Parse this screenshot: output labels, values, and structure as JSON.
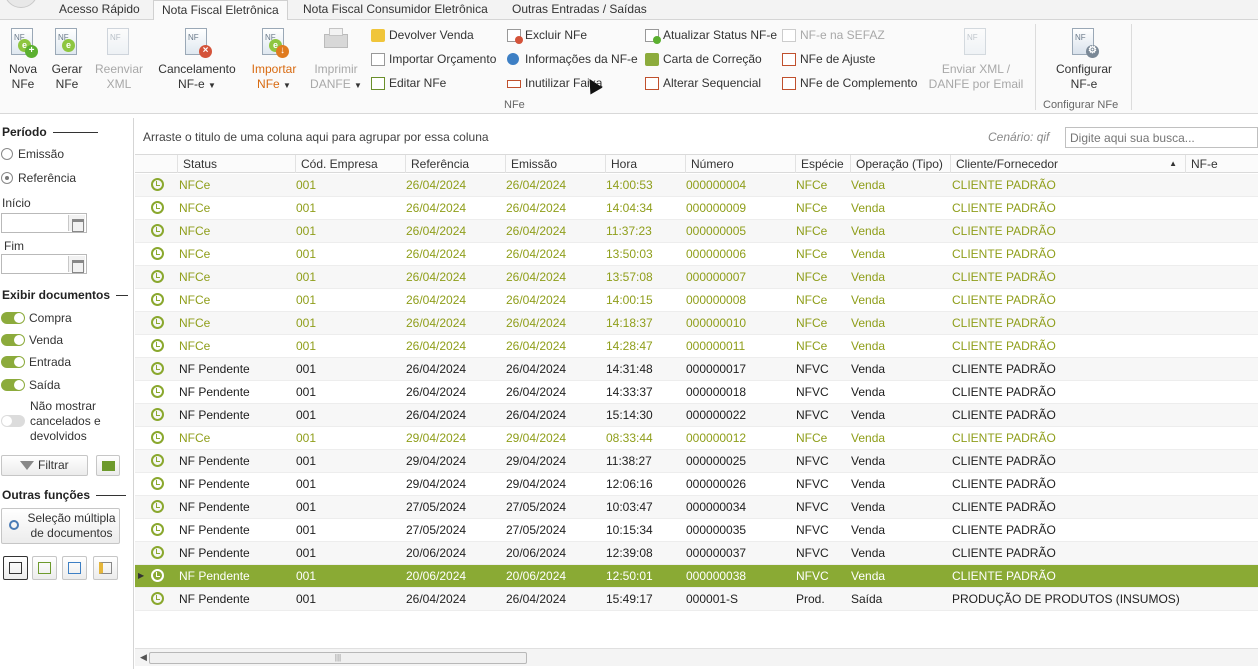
{
  "tabs": [
    "Acesso Rápido",
    "Nota Fiscal Eletrônica",
    "Nota Fiscal Consumidor Eletrônica",
    "Outras Entradas / Saídas"
  ],
  "ribbon": {
    "nova": [
      "Nova",
      "NFe"
    ],
    "gerar": [
      "Gerar",
      "NFe"
    ],
    "reenviar": [
      "Reenviar",
      "XML"
    ],
    "cancelamento": [
      "Cancelamento",
      "NF-e"
    ],
    "importar": [
      "Importar",
      "NFe"
    ],
    "imprimir": [
      "Imprimir",
      "DANFE"
    ],
    "devolver": "Devolver Venda",
    "importar_orc": "Importar Orçamento",
    "editar": "Editar NFe",
    "excluir": "Excluir NFe",
    "informacoes": "Informações da NF-e",
    "inutilizar": "Inutilizar Faixa",
    "atualizar": "Atualizar Status NF-e",
    "carta": "Carta de Correção",
    "alterar_seq": "Alterar Sequencial",
    "nfe_sefaz": "NF-e na SEFAZ",
    "ajuste": "NFe de Ajuste",
    "complemento": "NFe de Complemento",
    "enviar_xml": [
      "Enviar XML /",
      "DANFE por Email"
    ],
    "configurar": [
      "Configurar",
      "NF-e"
    ],
    "group_nfe": "NFe",
    "group_config": "Configurar NFe"
  },
  "sidebar": {
    "periodo": "Período",
    "emissao": "Emissão",
    "referencia": "Referência",
    "inicio": "Início",
    "fim": "Fim",
    "exibir": "Exibir documentos",
    "compra": "Compra",
    "venda": "Venda",
    "entrada": "Entrada",
    "saida": "Saída",
    "nao_mostrar": [
      "Não mostrar",
      "cancelados e",
      "devolvidos"
    ],
    "filtrar": "Filtrar",
    "outras": "Outras funções",
    "selecao": [
      "Seleção múltipla",
      "de documentos"
    ]
  },
  "grid": {
    "group_hint": "Arraste o titulo de uma coluna aqui para agrupar por essa coluna",
    "scenario": "Cenário: qif",
    "search_placeholder": "Digite aqui sua busca...",
    "columns": [
      "Status",
      "Cód. Empresa",
      "Referência",
      "Emissão",
      "Hora",
      "Número",
      "Espécie",
      "Operação (Tipo)",
      "Cliente/Fornecedor",
      "NF-e"
    ],
    "rows": [
      [
        "NFCe",
        "001",
        "26/04/2024",
        "26/04/2024",
        "14:00:53",
        "000000004",
        "NFCe",
        "Venda",
        "CLIENTE PADRÃO"
      ],
      [
        "NFCe",
        "001",
        "26/04/2024",
        "26/04/2024",
        "14:04:34",
        "000000009",
        "NFCe",
        "Venda",
        "CLIENTE PADRÃO"
      ],
      [
        "NFCe",
        "001",
        "26/04/2024",
        "26/04/2024",
        "11:37:23",
        "000000005",
        "NFCe",
        "Venda",
        "CLIENTE PADRÃO"
      ],
      [
        "NFCe",
        "001",
        "26/04/2024",
        "26/04/2024",
        "13:50:03",
        "000000006",
        "NFCe",
        "Venda",
        "CLIENTE PADRÃO"
      ],
      [
        "NFCe",
        "001",
        "26/04/2024",
        "26/04/2024",
        "13:57:08",
        "000000007",
        "NFCe",
        "Venda",
        "CLIENTE PADRÃO"
      ],
      [
        "NFCe",
        "001",
        "26/04/2024",
        "26/04/2024",
        "14:00:15",
        "000000008",
        "NFCe",
        "Venda",
        "CLIENTE PADRÃO"
      ],
      [
        "NFCe",
        "001",
        "26/04/2024",
        "26/04/2024",
        "14:18:37",
        "000000010",
        "NFCe",
        "Venda",
        "CLIENTE PADRÃO"
      ],
      [
        "NFCe",
        "001",
        "26/04/2024",
        "26/04/2024",
        "14:28:47",
        "000000011",
        "NFCe",
        "Venda",
        "CLIENTE PADRÃO"
      ],
      [
        "NF Pendente",
        "001",
        "26/04/2024",
        "26/04/2024",
        "14:31:48",
        "000000017",
        "NFVC",
        "Venda",
        "CLIENTE PADRÃO"
      ],
      [
        "NF Pendente",
        "001",
        "26/04/2024",
        "26/04/2024",
        "14:33:37",
        "000000018",
        "NFVC",
        "Venda",
        "CLIENTE PADRÃO"
      ],
      [
        "NF Pendente",
        "001",
        "26/04/2024",
        "26/04/2024",
        "15:14:30",
        "000000022",
        "NFVC",
        "Venda",
        "CLIENTE PADRÃO"
      ],
      [
        "NFCe",
        "001",
        "29/04/2024",
        "29/04/2024",
        "08:33:44",
        "000000012",
        "NFCe",
        "Venda",
        "CLIENTE PADRÃO"
      ],
      [
        "NF Pendente",
        "001",
        "29/04/2024",
        "29/04/2024",
        "11:38:27",
        "000000025",
        "NFVC",
        "Venda",
        "CLIENTE PADRÃO"
      ],
      [
        "NF Pendente",
        "001",
        "29/04/2024",
        "29/04/2024",
        "12:06:16",
        "000000026",
        "NFVC",
        "Venda",
        "CLIENTE PADRÃO"
      ],
      [
        "NF Pendente",
        "001",
        "27/05/2024",
        "27/05/2024",
        "10:03:47",
        "000000034",
        "NFVC",
        "Venda",
        "CLIENTE PADRÃO"
      ],
      [
        "NF Pendente",
        "001",
        "27/05/2024",
        "27/05/2024",
        "10:15:34",
        "000000035",
        "NFVC",
        "Venda",
        "CLIENTE PADRÃO"
      ],
      [
        "NF Pendente",
        "001",
        "20/06/2024",
        "20/06/2024",
        "12:39:08",
        "000000037",
        "NFVC",
        "Venda",
        "CLIENTE PADRÃO"
      ],
      [
        "NF Pendente",
        "001",
        "20/06/2024",
        "20/06/2024",
        "12:50:01",
        "000000038",
        "NFVC",
        "Venda",
        "CLIENTE PADRÃO"
      ],
      [
        "NF Pendente",
        "001",
        "26/04/2024",
        "26/04/2024",
        "15:49:17",
        "000001-S",
        "Prod.",
        "Saída",
        "PRODUÇÃO DE PRODUTOS (INSUMOS)"
      ]
    ],
    "selected_row": 17
  }
}
